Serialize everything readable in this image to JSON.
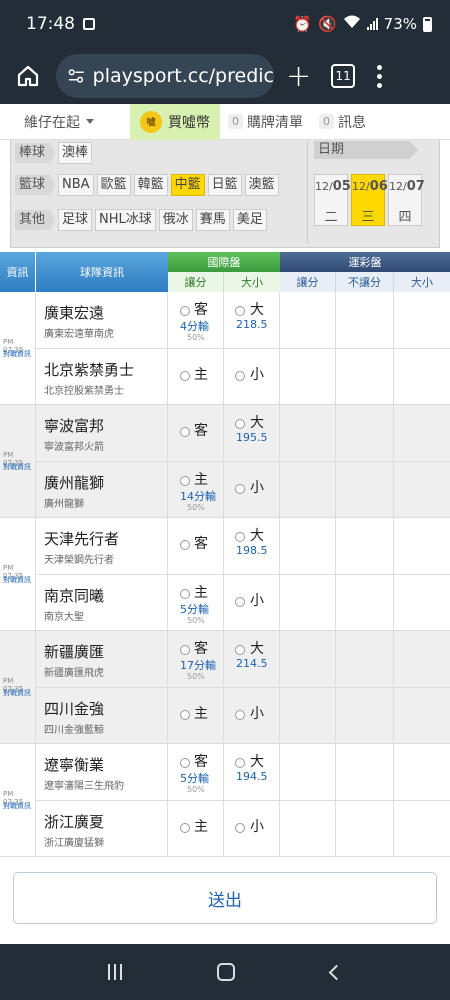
{
  "status": {
    "time": "17:48",
    "battery": "73%"
  },
  "browser": {
    "url": "playsport.cc/predic",
    "tabs": "11"
  },
  "topnav": {
    "bundle": "維仔在起",
    "buy": "買噓幣",
    "coin_label": "噓",
    "cart_count": "0",
    "cart": "購牌清單",
    "msg_count": "0",
    "msg": "訊息"
  },
  "filter": {
    "row1": {
      "cat": "棒球",
      "items": [
        "澳棒"
      ]
    },
    "row2": {
      "cat": "籃球",
      "items": [
        "NBA",
        "歐籃",
        "韓籃",
        "中籃",
        "日籃",
        "澳籃"
      ],
      "selected": "中籃"
    },
    "row3": {
      "cat": "其他",
      "items": [
        "足球",
        "NHL冰球",
        "俄冰",
        "賽馬",
        "美足"
      ]
    },
    "date_label": "日期",
    "days": [
      {
        "m": "12/",
        "d": "05",
        "w": "二"
      },
      {
        "m": "12/",
        "d": "06",
        "w": "三",
        "selected": true
      },
      {
        "m": "12/",
        "d": "07",
        "w": "四"
      }
    ]
  },
  "header": {
    "info": "資訊",
    "team": "球隊資訊",
    "intl": "國際盤",
    "intl_spread": "讓分",
    "intl_total": "大小",
    "lottery": "運彩盤",
    "lot_spread": "讓分",
    "lot_nospread": "不讓分",
    "lot_total": "大小"
  },
  "games": [
    {
      "time": "PM 07:35",
      "link": "對戰資訊",
      "away": {
        "name": "廣東宏遠",
        "sub": "廣東宏遠華南虎",
        "side": "客",
        "spread": "4分輸",
        "pct": "50%",
        "total_label": "大",
        "total": "218.5"
      },
      "home": {
        "name": "北京紫禁勇士",
        "sub": "北京控股紫禁勇士",
        "side": "主",
        "spread": "",
        "pct": "",
        "total_label": "小",
        "total": ""
      }
    },
    {
      "time": "PM 07:35",
      "link": "對戰資訊",
      "away": {
        "name": "寧波富邦",
        "sub": "寧波富邦火箭",
        "side": "客",
        "spread": "",
        "pct": "",
        "total_label": "大",
        "total": "195.5"
      },
      "home": {
        "name": "廣州龍獅",
        "sub": "廣州龍獅",
        "side": "主",
        "spread": "14分輸",
        "pct": "50%",
        "total_label": "小",
        "total": ""
      }
    },
    {
      "time": "PM 07:35",
      "link": "對戰資訊",
      "away": {
        "name": "天津先行者",
        "sub": "天津榮鋼先行者",
        "side": "客",
        "spread": "",
        "pct": "",
        "total_label": "大",
        "total": "198.5"
      },
      "home": {
        "name": "南京同曦",
        "sub": "南京大聖",
        "side": "主",
        "spread": "5分輸",
        "pct": "50%",
        "total_label": "小",
        "total": ""
      }
    },
    {
      "time": "PM 07:35",
      "link": "對戰資訊",
      "away": {
        "name": "新疆廣匯",
        "sub": "新疆廣匯飛虎",
        "side": "客",
        "spread": "17分輸",
        "pct": "50%",
        "total_label": "大",
        "total": "214.5"
      },
      "home": {
        "name": "四川金強",
        "sub": "四川金強藍鯨",
        "side": "主",
        "spread": "",
        "pct": "",
        "total_label": "小",
        "total": ""
      }
    },
    {
      "time": "PM 07:35",
      "link": "對戰資訊",
      "away": {
        "name": "遼寧衡業",
        "sub": "遼寧瀋陽三生飛豹",
        "side": "客",
        "spread": "5分輸",
        "pct": "50%",
        "total_label": "大",
        "total": "194.5"
      },
      "home": {
        "name": "浙江廣夏",
        "sub": "浙江廣廈猛獅",
        "side": "主",
        "spread": "",
        "pct": "",
        "total_label": "小",
        "total": ""
      }
    }
  ],
  "submit": "送出"
}
